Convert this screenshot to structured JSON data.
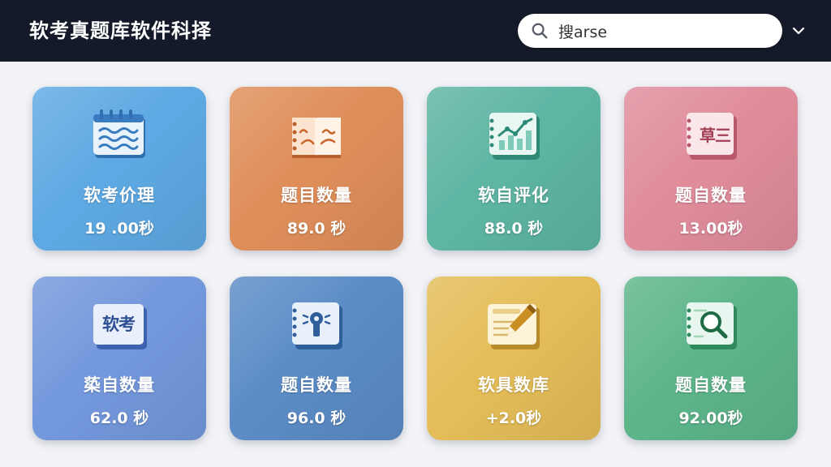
{
  "header": {
    "title": "软考真题库软件科择",
    "search": {
      "value": "搜arse",
      "icon": "search-icon"
    },
    "dropdown_icon": "chevron-down-icon"
  },
  "cards": [
    {
      "title": "软考价理",
      "value": "19 .00秒",
      "color": "#5ea9e3",
      "icon": "book-waves-icon"
    },
    {
      "title": "题目数量",
      "value": "89.0 秒",
      "color": "#df8e59",
      "icon": "open-book-icon"
    },
    {
      "title": "软自评化",
      "value": "88.0 秒",
      "color": "#5db5a2",
      "icon": "book-chart-icon"
    },
    {
      "title": "题自数量",
      "value": "13.00秒",
      "color": "#e08c9b",
      "icon": "book-text-icon",
      "icon_text": "草三"
    },
    {
      "title": "蒅自数量",
      "value": "62.0  秒",
      "color": "#7398dc",
      "icon": "book-text-icon",
      "icon_text": "软考"
    },
    {
      "title": "题自数量",
      "value": "96.0  秒",
      "color": "#5b8cc6",
      "icon": "book-lock-icon"
    },
    {
      "title": "软具数库",
      "value": "+2.0秒",
      "color": "#e4bd58",
      "icon": "notebook-pencil-icon"
    },
    {
      "title": "题自数量",
      "value": "92.00秒",
      "color": "#5db58a",
      "icon": "book-search-icon"
    }
  ]
}
